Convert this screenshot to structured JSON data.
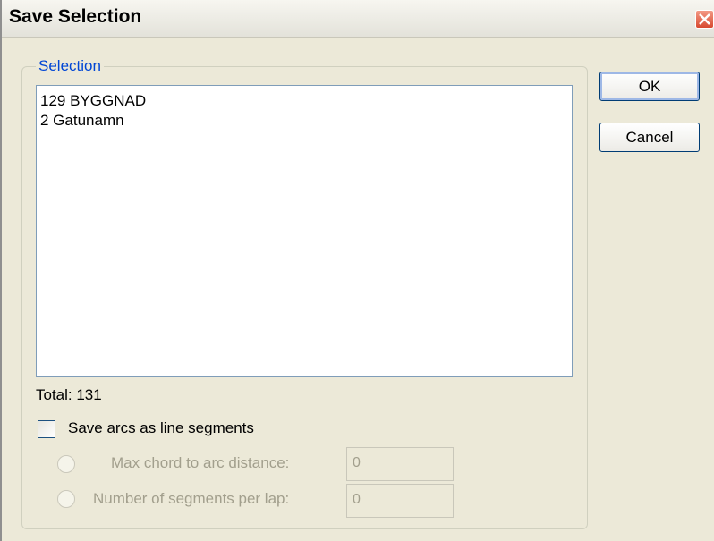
{
  "window": {
    "title": "Save Selection"
  },
  "selection_group": {
    "label": "Selection",
    "items": [
      "129 BYGGNAD",
      "2 Gatunamn"
    ],
    "total_text": "Total: 131"
  },
  "options": {
    "save_arcs_label": "Save arcs as line segments",
    "save_arcs_checked": false,
    "max_chord_label": "Max chord to arc distance:",
    "max_chord_value": "0",
    "segments_per_lap_label": "Number of segments per lap:",
    "segments_per_lap_value": "0"
  },
  "buttons": {
    "ok_label": "OK",
    "cancel_label": "Cancel"
  },
  "colors": {
    "group_label": "#0046d5",
    "disabled_text": "#a29f8d",
    "dialog_bg": "#ece9d8"
  }
}
